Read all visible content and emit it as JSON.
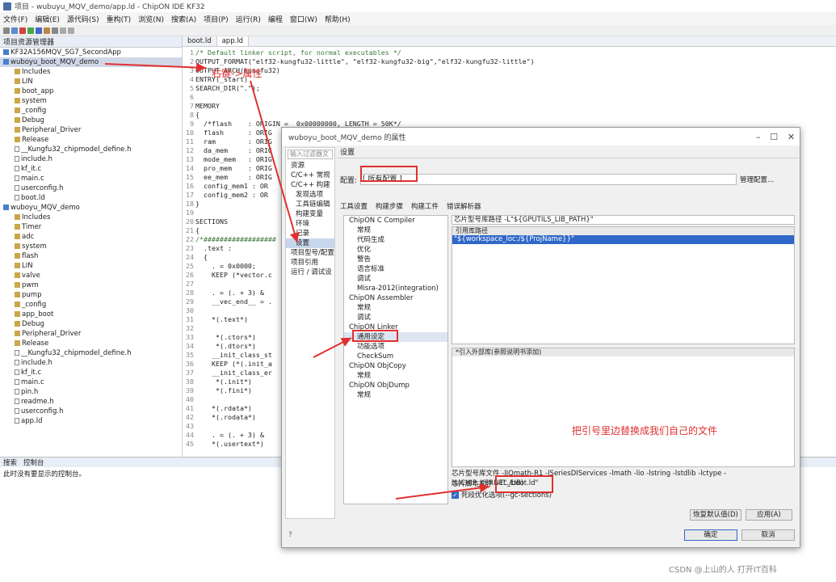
{
  "window": {
    "title": "项目 - wubuyu_MQV_demo/app.ld - ChipON IDE KF32"
  },
  "menu": [
    "文件(F)",
    "编辑(E)",
    "源代码(S)",
    "重构(T)",
    "浏览(N)",
    "搜索(A)",
    "项目(P)",
    "运行(R)",
    "编程",
    "窗口(W)",
    "帮助(H)"
  ],
  "project_panel": {
    "title": "项目资源管理器"
  },
  "tree": [
    "KF32A156MQV_SG7_SecondApp",
    "wuboyu_boot_MQV_demo",
    "Includes",
    "LIN",
    "boot_app",
    "system",
    "_config",
    "Debug",
    "Peripheral_Driver",
    "Release",
    "__Kungfu32_chipmodel_define.h",
    "include.h",
    "kf_it.c",
    "main.c",
    "userconfig.h",
    "boot.ld",
    "wuboyu_MQV_demo",
    "Includes",
    "Timer",
    "adc",
    "system",
    "flash",
    "LIN",
    "valve",
    "pwm",
    "pump",
    "_config",
    "app_boot",
    "Debug",
    "Peripheral_Driver",
    "Release",
    "__Kungfu32_chipmodel_define.h",
    "include.h",
    "kf_it.c",
    "main.c",
    "pin.h",
    "readme.h",
    "userconfig.h",
    "app.ld"
  ],
  "editor": {
    "tabs": [
      "boot.ld",
      "app.ld"
    ],
    "lines": [
      "/* Default linker script, for normal executables */",
      "OUTPUT_FORMAT(\"elf32-kungfu32-little\", \"elf32-kungfu32-big\",\"elf32-kungfu32-little\")",
      "OUTPUT_ARCH(kungfu32)",
      "ENTRY(_start)",
      "SEARCH_DIR(\".\");",
      "",
      "MEMORY",
      "{",
      "  /*flash    : ORIGIN =  0x00000000, LENGTH = 50K*/",
      "  flash      : ORIG",
      "  ram        : ORIG",
      "  da_mem     : ORIG",
      "  mode_mem   : ORIG",
      "  pro_mem    : ORIG",
      "  ee_mem     : ORIG",
      "  config_mem1 : OR",
      "  config_mem2 : OR",
      "}",
      "",
      "SECTIONS",
      "{",
      "/*##################",
      "  .text :",
      "  {",
      "    . = 0x0000;",
      "    KEEP (*vector.c",
      "",
      "    . = (. + 3) &",
      "    __vec_end__ = .",
      "",
      "    *(.text*)",
      "",
      "     *(.ctors*)",
      "     *(.dtors*)",
      "    __init_class_st",
      "    KEEP (*(.init_a",
      "    __init_class_er",
      "     *(.init*)",
      "     *(.fini*)",
      "",
      "    *(.rdata*)",
      "    *(.rodata*)",
      "",
      "    . = (. + 3) &",
      "    *(.usertext*)"
    ]
  },
  "bottom": {
    "tabs": [
      "搜索",
      "控制台"
    ],
    "message": "此时没有要显示的控制台。"
  },
  "dialog": {
    "title": "wuboyu_boot_MQV_demo 的属性",
    "filter_placeholder": "输入过滤器文",
    "nav": [
      "资源",
      "C/C++ 常规",
      "C/C++ 构建",
      "发现选项",
      "工具链编辑",
      "构建变量",
      "环境",
      "记录",
      "设置",
      "项目型号/配置",
      "项目引用",
      "运行 / 调试设"
    ],
    "heading": "设置",
    "config_label": "配置:",
    "config_value": "[ 所有配置 ]",
    "manage_button": "管理配置...",
    "subtabs": [
      "工具设置",
      "构建步骤",
      "构建工件",
      "错误解析器"
    ],
    "tool_tree": [
      "ChipON C Compiler",
      "常规",
      "代码生成",
      "优化",
      "警告",
      "语言标准",
      "调试",
      "Misra-2012(integration)",
      "ChipON Assembler",
      "常规",
      "调试",
      "ChipON Linker",
      "通用设定",
      "功能选项",
      "CheckSum",
      "ChipON ObjCopy",
      "常规",
      "ChipON ObjDump",
      "常规"
    ],
    "lib_path_label": "芯片型号库路径 -L\"${GPUTILS_LIB_PATH}\"",
    "ref_lib_header": "引用库路径",
    "ref_lib_value": "\"${workspace_loc:/${ProjName}}\"",
    "ext_lib_header": "*引入外部库(参照说明书添加)",
    "chip_lib_label": "芯片型号库文件 -lIQmath-R1 -lSeriesDIServices -lmath -lio -lstring -lstdlib -lctype -l$(CHIP_KERNEL_LIB)",
    "script_label": "芯片脚本文件",
    "script_value": "-T\"./boot.ld\"",
    "gc_option": "死段优化选项(--gc-sections)",
    "restore_button": "恢复默认值(D)",
    "apply_button": "应用(A)",
    "ok_button": "确定",
    "cancel_button": "取消"
  },
  "annotations": {
    "right_click": "右键->属性",
    "replace_hint": "把引号里边替换成我们自己的文件"
  },
  "watermark": "CSDN @上山的人 打开IT百科"
}
